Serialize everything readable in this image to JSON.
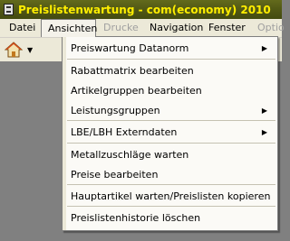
{
  "window": {
    "title": "Preislistenwartung - com(economy) 2010"
  },
  "menubar": {
    "items": [
      {
        "label": "Datei"
      },
      {
        "label": "Ansichten"
      },
      {
        "label": "Drucke"
      },
      {
        "label": "Navigation"
      },
      {
        "label": "Fenster"
      },
      {
        "label": "Optio"
      }
    ]
  },
  "toolbar": {
    "home_icon": "home-icon",
    "dropdown_icon": "dropdown-arrow-icon"
  },
  "ansichten_menu": {
    "items": [
      {
        "label": "Preiswartung Datanorm",
        "submenu": true
      },
      {
        "label": "Rabattmatrix bearbeiten",
        "submenu": false
      },
      {
        "label": "Artikelgruppen bearbeiten",
        "submenu": false
      },
      {
        "label": "Leistungsgruppen",
        "submenu": true
      },
      {
        "label": "LBE/LBH Externdaten",
        "submenu": true
      },
      {
        "label": "Metallzuschläge warten",
        "submenu": false
      },
      {
        "label": "Preise bearbeiten",
        "submenu": false
      },
      {
        "label": "Hauptartikel warten/Preislisten kopieren",
        "submenu": false
      },
      {
        "label": "Preislistenhistorie löschen",
        "submenu": false
      }
    ]
  },
  "colors": {
    "title_bg": "#4f5614",
    "title_text": "#ffee00",
    "workspace": "#808080"
  }
}
